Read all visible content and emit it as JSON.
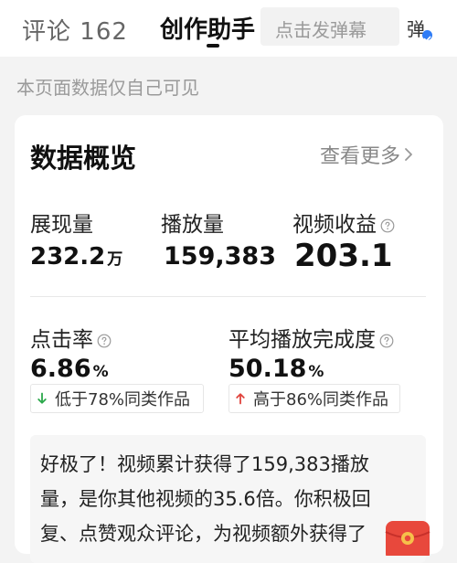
{
  "header": {
    "tab_comment_label": "评论",
    "tab_comment_count": "162",
    "tab_assistant_label": "创作助手",
    "danmu_placeholder": "点击发弹幕",
    "danmu_toggle_label": "弹"
  },
  "page_hint": "本页面数据仅自己可见",
  "card": {
    "title": "数据概览",
    "view_more": "查看更多",
    "metrics": {
      "impressions": {
        "label": "展现量",
        "value": "232.2",
        "unit": "万"
      },
      "plays": {
        "label": "播放量",
        "value": "159,383"
      },
      "revenue": {
        "label": "视频收益",
        "value": "203.1"
      },
      "ctr": {
        "label": "点击率",
        "value": "6.86",
        "unit": "%"
      },
      "completion": {
        "label": "平均播放完成度",
        "value": "50.18",
        "unit": "%"
      }
    },
    "compare": {
      "ctr": "低于78%同类作品",
      "completion": "高于86%同类作品"
    },
    "summary_lines": [
      "好极了！视频累计获得了159,383播放",
      "量，是你其他视频的35.6倍。你积极回",
      "复、点赞观众评论，为视频额外获得了"
    ]
  },
  "colors": {
    "down_arrow": "#2aa84a",
    "up_arrow": "#e0433c",
    "toggle_badge": "#2f7cf6",
    "redpack": "#e8483c"
  },
  "icons": {
    "help": "question-circle-icon",
    "view_more": "chevron-right-icon",
    "down": "arrow-down-icon",
    "up": "arrow-up-icon",
    "float": "red-packet-icon"
  }
}
